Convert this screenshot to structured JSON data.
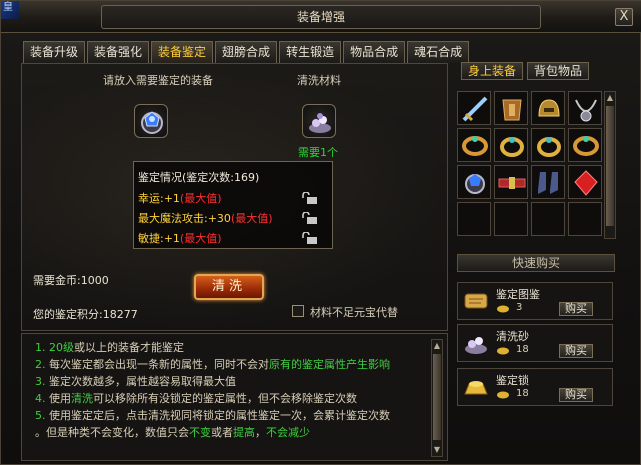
{
  "window": {
    "title": "装备增强",
    "close_glyph": "X",
    "corner_text": "皇"
  },
  "tabs": [
    {
      "label": "装备升级",
      "active": false
    },
    {
      "label": "装备强化",
      "active": false
    },
    {
      "label": "装备鉴定",
      "active": true
    },
    {
      "label": "翅膀合成",
      "active": false
    },
    {
      "label": "转生锻造",
      "active": false
    },
    {
      "label": "物品合成",
      "active": false
    },
    {
      "label": "魂石合成",
      "active": false
    }
  ],
  "appraise": {
    "put_label": "请放入需要鉴定的装备",
    "wash_label": "清洗材料",
    "need_label": "需要1个",
    "status_title": "鉴定情况(鉴定次数:169)",
    "attributes": [
      {
        "name": "幸运:+1",
        "max": "(最大值)"
      },
      {
        "name": "最大魔法攻击:+30",
        "max": "(最大值)"
      },
      {
        "name": "敏捷:+1",
        "max": "(最大值)"
      }
    ],
    "gold_label": "需要金币:1000",
    "clean_button": "清洗",
    "score_label": "您的鉴定积分:18277",
    "checkbox_label": "材料不足元宝代替"
  },
  "info_lines": [
    {
      "num": "1.",
      "parts": [
        {
          "t": "20级",
          "c": "green"
        },
        {
          "t": "或以上的装备才能鉴定",
          "c": ""
        }
      ]
    },
    {
      "num": "2.",
      "parts": [
        {
          "t": "每次鉴定都会出现一条新的属性，同时不会对",
          "c": ""
        },
        {
          "t": "原有的鉴定属性产生影响",
          "c": "green"
        }
      ]
    },
    {
      "num": "3.",
      "parts": [
        {
          "t": "鉴定次数越多，属性越容易取得最大值",
          "c": ""
        }
      ]
    },
    {
      "num": "4.",
      "parts": [
        {
          "t": "使用",
          "c": ""
        },
        {
          "t": "清洗",
          "c": "green"
        },
        {
          "t": "可以移除所有没锁定的鉴定属性，但不会移除鉴定次数",
          "c": ""
        }
      ]
    },
    {
      "num": "5.",
      "parts": [
        {
          "t": "使用鉴定定后，点击清洗视同将锁定的属性鉴定一次，会累计鉴定次数",
          "c": ""
        }
      ]
    },
    {
      "num": "",
      "parts": [
        {
          "t": "。但是种类不会变化，数值只会",
          "c": ""
        },
        {
          "t": "不变",
          "c": "green"
        },
        {
          "t": "或者",
          "c": ""
        },
        {
          "t": "提高",
          "c": "green"
        },
        {
          "t": "，",
          "c": ""
        },
        {
          "t": "不会减少",
          "c": "green"
        }
      ]
    }
  ],
  "right_tabs": [
    {
      "label": "身上装备",
      "active": true
    },
    {
      "label": "背包物品",
      "active": false
    }
  ],
  "equipment_grid": [
    "sword-icon",
    "armor-icon",
    "helmet-icon",
    "necklace-icon",
    "bracelet-icon",
    "ring-icon",
    "ring-icon",
    "bracelet-icon",
    "gem-ring-icon",
    "belt-icon",
    "boots-icon",
    "ruby-icon",
    "",
    "",
    "",
    ""
  ],
  "quick_buy_label": "快速购买",
  "shop": [
    {
      "name": "鉴定图鉴",
      "qty": "3",
      "buy": "购买",
      "icon": "scroll-icon"
    },
    {
      "name": "清洗砂",
      "qty": "18",
      "buy": "购买",
      "icon": "sand-icon"
    },
    {
      "name": "鉴定锁",
      "qty": "18",
      "buy": "购买",
      "icon": "gold-ingot-icon"
    }
  ]
}
